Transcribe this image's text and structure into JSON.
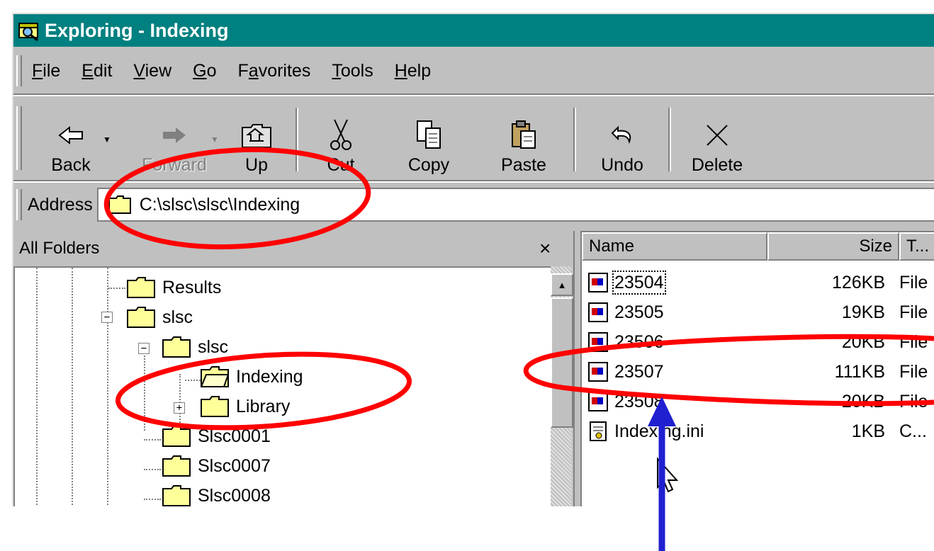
{
  "window": {
    "title": "Exploring - Indexing"
  },
  "menu": [
    {
      "label": "File",
      "accel": "F",
      "rest": "ile"
    },
    {
      "label": "Edit",
      "accel": "E",
      "rest": "dit"
    },
    {
      "label": "View",
      "accel": "V",
      "rest": "iew"
    },
    {
      "label": "Go",
      "accel": "G",
      "rest": "o"
    },
    {
      "label": "Favorites",
      "pre": "F",
      "accel": "a",
      "rest": "vorites"
    },
    {
      "label": "Tools",
      "accel": "T",
      "rest": "ools"
    },
    {
      "label": "Help",
      "accel": "H",
      "rest": "elp"
    }
  ],
  "toolbar": {
    "back": "Back",
    "forward": "Forward",
    "up": "Up",
    "cut": "Cut",
    "copy": "Copy",
    "paste": "Paste",
    "undo": "Undo",
    "delete": "Delete"
  },
  "address": {
    "label": "Address",
    "value": "C:\\slsc\\slsc\\Indexing"
  },
  "folders": {
    "header": "All Folders",
    "close": "×",
    "items": [
      "Results",
      "slsc",
      "slsc",
      "Indexing",
      "Library",
      "Slsc0001",
      "Slsc0007",
      "Slsc0008"
    ]
  },
  "files": {
    "columns": {
      "name": "Name",
      "size": "Size",
      "type": "T..."
    },
    "rows": [
      {
        "name": "23504",
        "size": "126KB",
        "type": "File"
      },
      {
        "name": "23505",
        "size": "19KB",
        "type": "File"
      },
      {
        "name": "23506",
        "size": "20KB",
        "type": "File"
      },
      {
        "name": "23507",
        "size": "111KB",
        "type": "File"
      },
      {
        "name": "23508",
        "size": "20KB",
        "type": "File"
      },
      {
        "name": "Indexing.ini",
        "size": "1KB",
        "type": "C..."
      }
    ]
  },
  "colors": {
    "titlebar": "#008080",
    "annotation_circle": "#ff0000",
    "annotation_arrow": "#2020d0"
  }
}
